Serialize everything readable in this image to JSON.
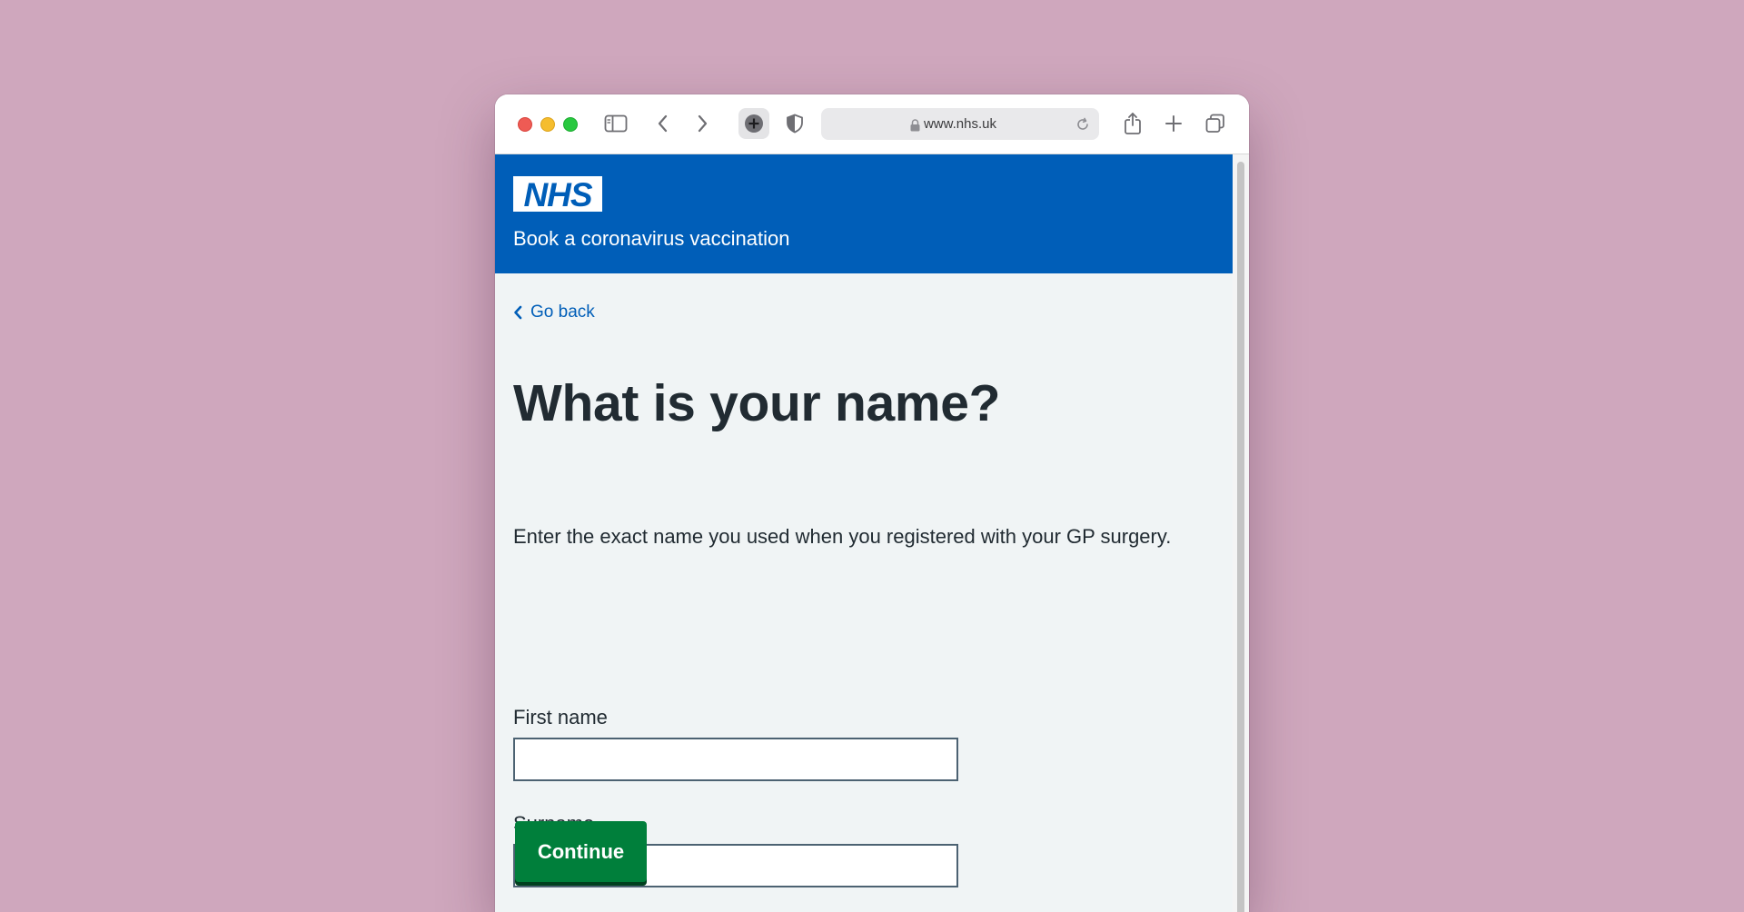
{
  "browser": {
    "url": "www.nhs.uk",
    "icons": {
      "sidebar": "sidebar-icon",
      "back": "chevron-left-icon",
      "forward": "chevron-right-icon",
      "extension": "plus-circle-icon",
      "shield": "shield-icon",
      "lock": "lock-icon",
      "reload": "reload-icon",
      "share": "share-icon",
      "new_tab": "plus-icon",
      "tabs": "tabs-overview-icon"
    }
  },
  "header": {
    "logo_text": "NHS",
    "service_name": "Book a coronavirus vaccination"
  },
  "page": {
    "back_link": "Go back",
    "title": "What is your name?",
    "hint": "Enter the exact name you used when you registered with your GP surgery.",
    "first_name": {
      "label": "First name",
      "value": ""
    },
    "surname": {
      "label": "Surname",
      "value": ""
    },
    "continue_label": "Continue"
  },
  "colors": {
    "nhs_blue": "#005eb8",
    "button_green": "#007f3b",
    "background": "#cfa7bd",
    "page_background": "#f0f4f5",
    "text": "#212b32"
  }
}
